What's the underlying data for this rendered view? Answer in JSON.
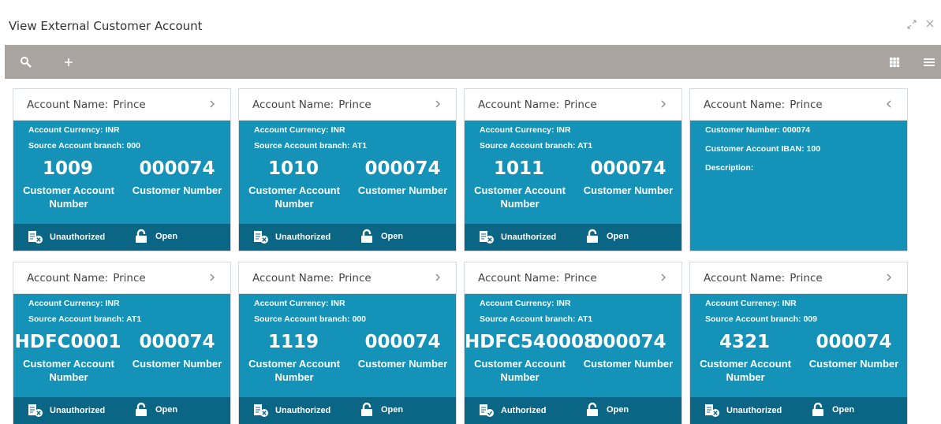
{
  "window": {
    "title": "View External Customer Account"
  },
  "labels": {
    "account_name": "Account Name:",
    "currency": "Account Currency:",
    "branch": "Source Account branch:",
    "cust_acc_line1": "Customer Account",
    "cust_acc_line2": "Number",
    "cust_num": "Customer Number",
    "customer_number_label": "Customer Number:",
    "iban_label": "Customer Account IBAN:",
    "description_label": "Description:",
    "open": "Open"
  },
  "cards": [
    {
      "account_name": "Prince",
      "currency": "INR",
      "branch": "000",
      "account_number": "1009",
      "customer_number": "000074",
      "auth": "Unauthorized",
      "status": "Open"
    },
    {
      "account_name": "Prince",
      "currency": "INR",
      "branch": "AT1",
      "account_number": "1010",
      "customer_number": "000074",
      "auth": "Unauthorized",
      "status": "Open"
    },
    {
      "account_name": "Prince",
      "currency": "INR",
      "branch": "AT1",
      "account_number": "1011",
      "customer_number": "000074",
      "auth": "Unauthorized",
      "status": "Open"
    },
    {
      "account_name": "Prince",
      "flipped": true,
      "customer_number": "000074",
      "iban": "100",
      "description": ""
    },
    {
      "account_name": "Prince",
      "currency": "INR",
      "branch": "AT1",
      "account_number": "HDFC0001",
      "customer_number": "000074",
      "auth": "Unauthorized",
      "status": "Open"
    },
    {
      "account_name": "Prince",
      "currency": "INR",
      "branch": "000",
      "account_number": "1119",
      "customer_number": "000074",
      "auth": "Unauthorized",
      "status": "Open"
    },
    {
      "account_name": "Prince",
      "currency": "INR",
      "branch": "AT1",
      "account_number": "HDFC540008",
      "customer_number": "000074",
      "auth": "Authorized",
      "status": "Open"
    },
    {
      "account_name": "Prince",
      "currency": "INR",
      "branch": "009",
      "account_number": "4321",
      "customer_number": "000074",
      "auth": "Unauthorized",
      "status": "Open"
    }
  ],
  "colors": {
    "toolbar": "#a9a49f",
    "card_body": "#1592b7",
    "card_footer": "#0b6584"
  },
  "icons": {
    "search": "search-icon",
    "add": "plus-icon",
    "grid": "grid-view-icon",
    "list": "list-view-icon",
    "minimize": "minimize-icon",
    "close": "close-icon"
  }
}
